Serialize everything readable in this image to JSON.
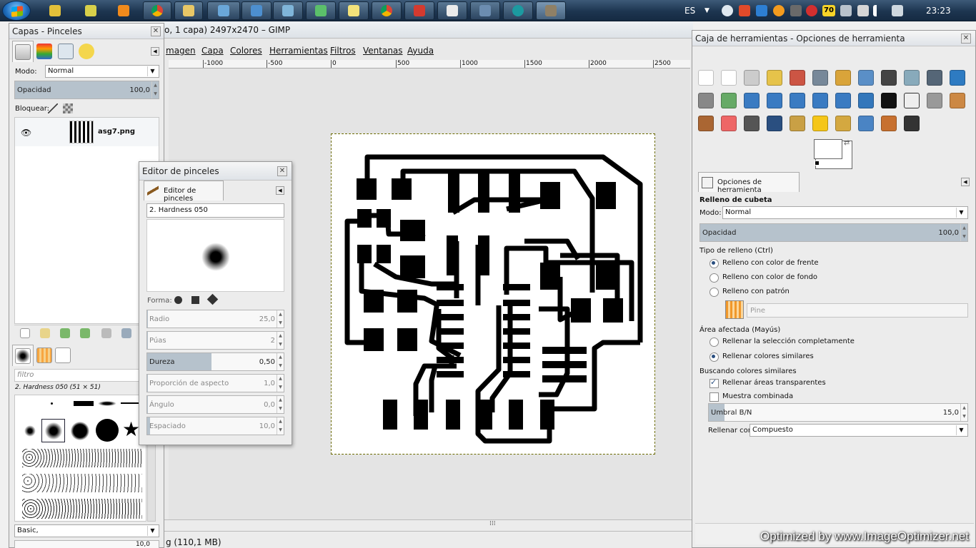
{
  "taskbar": {
    "language": "ES",
    "clock": "23:23",
    "badge": "70",
    "apps": [
      "winamp",
      "notepad-plus",
      "vlc",
      "chrome",
      "explorer",
      "windows-explorer",
      "remote-desktop",
      "notes",
      "git-tool",
      "sticky-notes",
      "chrome",
      "pdf-reader",
      "terminal",
      "monitor",
      "arduino",
      "gimp"
    ]
  },
  "main_window": {
    "title": "o, 1 capa) 2497x2470 – GIMP",
    "menu": [
      "magen",
      "Capa",
      "Colores",
      "Herramientas",
      "Filtros",
      "Ventanas",
      "Ayuda"
    ],
    "ruler_ticks": [
      "-1000",
      "-500",
      "0",
      "500",
      "1000",
      "1500",
      "2000",
      "2500"
    ],
    "status": "g (110,1 MB)",
    "scroll_glyph": "⁞⁞⁞"
  },
  "layers_panel": {
    "title": "Capas - Pinceles",
    "mode_label": "Modo:",
    "mode_value": "Normal",
    "opacity_label": "Opacidad",
    "opacity_value": "100,0",
    "opacity_fraction": 1.0,
    "lock_label": "Bloquear:",
    "layer_name": "asg7.png",
    "filter_placeholder": "filtro",
    "brush_selected": "2. Hardness 050 (51 × 51)",
    "brush_set": "Basic,",
    "bottom_value": "10,0"
  },
  "brush_editor": {
    "title": "Editor de pinceles",
    "tab_label": "Editor de pinceles",
    "brush_name": "2. Hardness 050",
    "shape_label": "Forma:",
    "sliders": [
      {
        "label": "Radio",
        "value": "25,0",
        "fraction": 0.0,
        "dim": true
      },
      {
        "label": "Púas",
        "value": "2",
        "fraction": 0.0,
        "dim": true
      },
      {
        "label": "Dureza",
        "value": "0,50",
        "fraction": 0.47,
        "dim": false
      },
      {
        "label": "Proporción de aspecto",
        "value": "1,0",
        "fraction": 0.0,
        "dim": true
      },
      {
        "label": "Ángulo",
        "value": "0,0",
        "fraction": 0.0,
        "dim": true
      },
      {
        "label": "Espaciado",
        "value": "10,0",
        "fraction": 0.02,
        "dim": true
      }
    ]
  },
  "tool_options": {
    "window_title": "Caja de herramientas - Opciones de herramienta",
    "tab_label": "Opciones de herramienta",
    "section_title": "Relleno de cubeta",
    "mode_label": "Modo:",
    "mode_value": "Normal",
    "opacity_label": "Opacidad",
    "opacity_value": "100,0",
    "opacity_fraction": 1.0,
    "fill_type_label": "Tipo de relleno  (Ctrl)",
    "fill_types": [
      {
        "label": "Relleno con color de frente",
        "on": true
      },
      {
        "label": "Relleno con color de fondo",
        "on": false
      },
      {
        "label": "Relleno con patrón",
        "on": false
      }
    ],
    "pattern_name": "Pine",
    "area_label": "Área afectada  (Mayús)",
    "areas": [
      {
        "label": "Rellenar la selección completamente",
        "on": false
      },
      {
        "label": "Rellenar colores similares",
        "on": true
      }
    ],
    "similar_label": "Buscando colores similares",
    "checks": [
      {
        "label": "Rellenar áreas transparentes",
        "on": true
      },
      {
        "label": "Muestra combinada",
        "on": false
      }
    ],
    "threshold_label": "Umbral B/N",
    "threshold_value": "15,0",
    "threshold_fraction": 0.06,
    "fill_with_label": "Rellenar con:",
    "fill_with_value": "Compuesto"
  },
  "watermark": "Optimized by  www.ImageOptimizer.net",
  "colors": {
    "taskbar": "#1d3550",
    "selection": "#b6c2cc",
    "pcb_trace": "#000000"
  }
}
